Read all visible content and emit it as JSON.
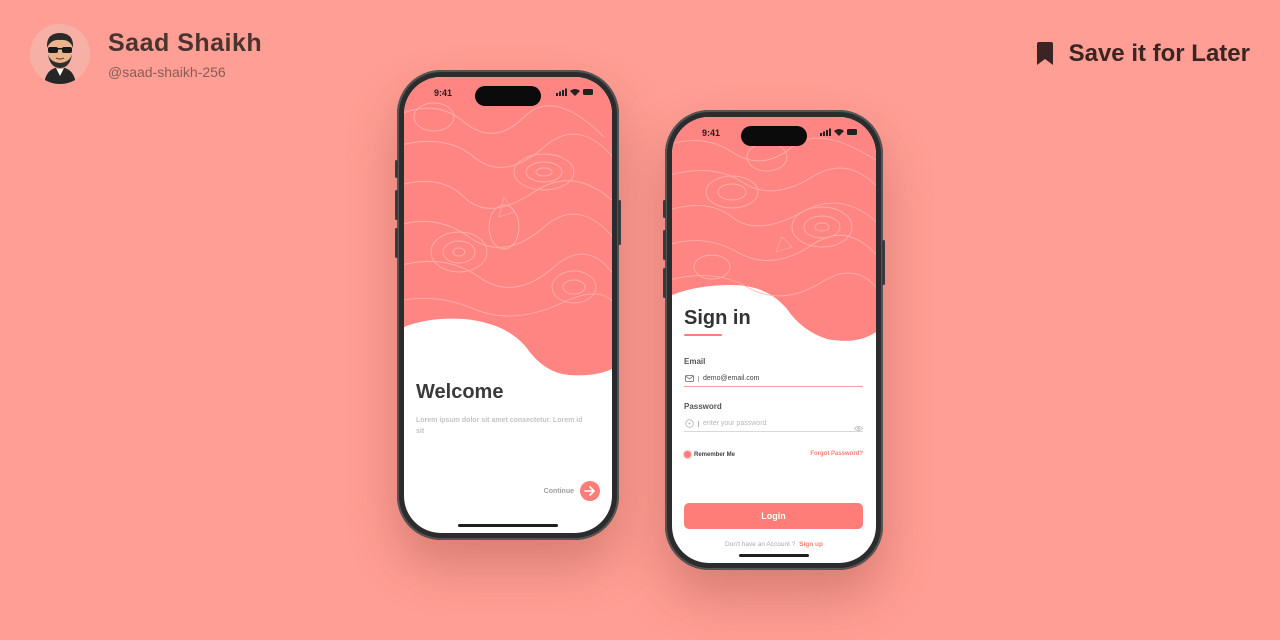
{
  "author": {
    "name": "Saad Shaikh",
    "handle": "@saad-shaikh-256",
    "avatar_icon": "avatar-icon"
  },
  "save": {
    "label": "Save it for Later",
    "icon": "bookmark-icon"
  },
  "status_bar": {
    "time": "9:41"
  },
  "welcome_screen": {
    "title": "Welcome",
    "body": "Lorem ipsum dolor sit amet consectetur. Lorem id sit",
    "continue_label": "Continue",
    "continue_icon": "arrow-right-icon"
  },
  "signin_screen": {
    "title": "Sign in",
    "email_label": "Email",
    "email_value": "demo@email.com",
    "password_label": "Password",
    "password_placeholder": "enter your password",
    "remember_label": "Remember Me",
    "forgot_label": "Forgot Password?",
    "login_label": "Login",
    "signup_question": "Don't have an Account ?",
    "signup_link": "Sign up"
  },
  "colors": {
    "background": "#ff9e94",
    "accent": "#ff7d79",
    "topo_fill": "#ff8582",
    "topo_line": "#ffb1ac"
  }
}
